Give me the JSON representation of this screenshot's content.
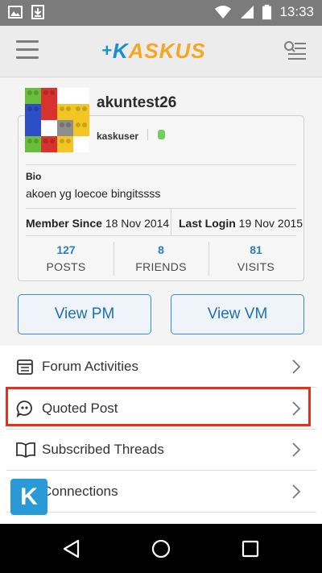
{
  "status_bar": {
    "time": "13:33",
    "icons": [
      "image-icon",
      "download-icon",
      "wifi-icon",
      "signal-icon",
      "battery-icon"
    ]
  },
  "app_bar": {
    "logo_k": "K",
    "logo_rest": "ASKUS",
    "logo_prefix": "+",
    "menu_icon": "hamburger-icon",
    "right_icon": "search-list-icon"
  },
  "profile": {
    "username": "akuntest26",
    "user_title": "kaskuser",
    "online_status_color": "#6fd05d",
    "bio_label": "Bio",
    "bio_text": "akoen yg loecoe bingitssss",
    "member_since_label": "Member Since",
    "member_since_value": "18 Nov 2014",
    "last_login_label": "Last Login",
    "last_login_value": "19 Nov 2015",
    "stats": [
      {
        "value": "127",
        "label": "POSTS"
      },
      {
        "value": "8",
        "label": "FRIENDS"
      },
      {
        "value": "81",
        "label": "VISITS"
      }
    ],
    "view_pm_label": "View PM",
    "view_vm_label": "View VM"
  },
  "menu": {
    "items": [
      {
        "label": "Forum Activities",
        "icon": "calendar-icon"
      },
      {
        "label": "Quoted Post",
        "icon": "quote-bubble-icon"
      },
      {
        "label": "Subscribed Threads",
        "icon": "open-book-icon"
      },
      {
        "label": "Connections",
        "icon": "people-icon"
      }
    ],
    "highlight_color": "#e2301b"
  },
  "fab": {
    "label": "K"
  },
  "colors": {
    "accent": "#1a8fcf",
    "logo_orange": "#f5a623",
    "button_blue": "#1f6fb7"
  }
}
